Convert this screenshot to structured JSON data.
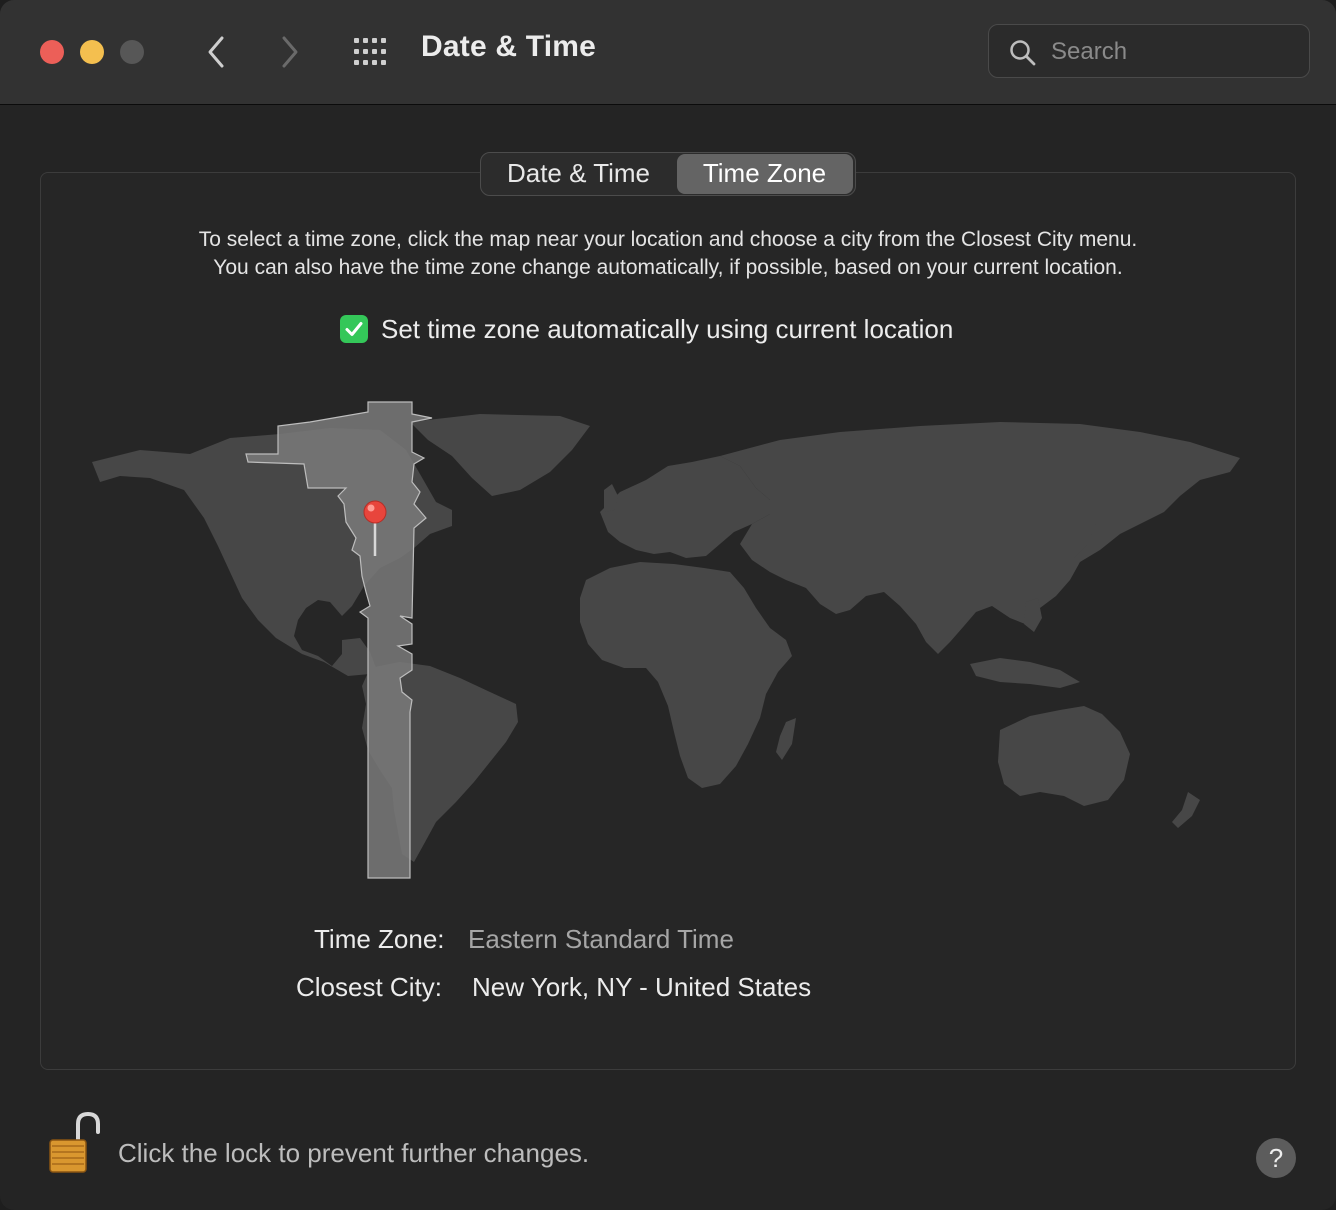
{
  "window": {
    "title": "Date & Time"
  },
  "toolbar": {
    "back_icon": "chevron-left-icon",
    "forward_icon": "chevron-right-icon",
    "show_all_icon": "grid-icon",
    "search_placeholder": "Search"
  },
  "tabs": [
    {
      "label": "Date & Time",
      "selected": false
    },
    {
      "label": "Time Zone",
      "selected": true
    }
  ],
  "instructions": {
    "line1": "To select a time zone, click the map near your location and choose a city from the Closest City menu.",
    "line2": "You can also have the time zone change automatically, if possible, based on your current location."
  },
  "auto_timezone": {
    "label": "Set time zone automatically using current location",
    "checked": true
  },
  "details": {
    "timezone_label": "Time Zone:",
    "timezone_value": "Eastern Standard Time",
    "city_label": "Closest City:",
    "city_value": "New York, NY - United States"
  },
  "footer": {
    "lock_text": "Click the lock to prevent further changes.",
    "lock_icon": "unlocked-padlock-icon",
    "help_label": "?"
  },
  "colors": {
    "checkbox": "#34c759",
    "pin": "#e8453c",
    "selected_tab": "#646464"
  }
}
